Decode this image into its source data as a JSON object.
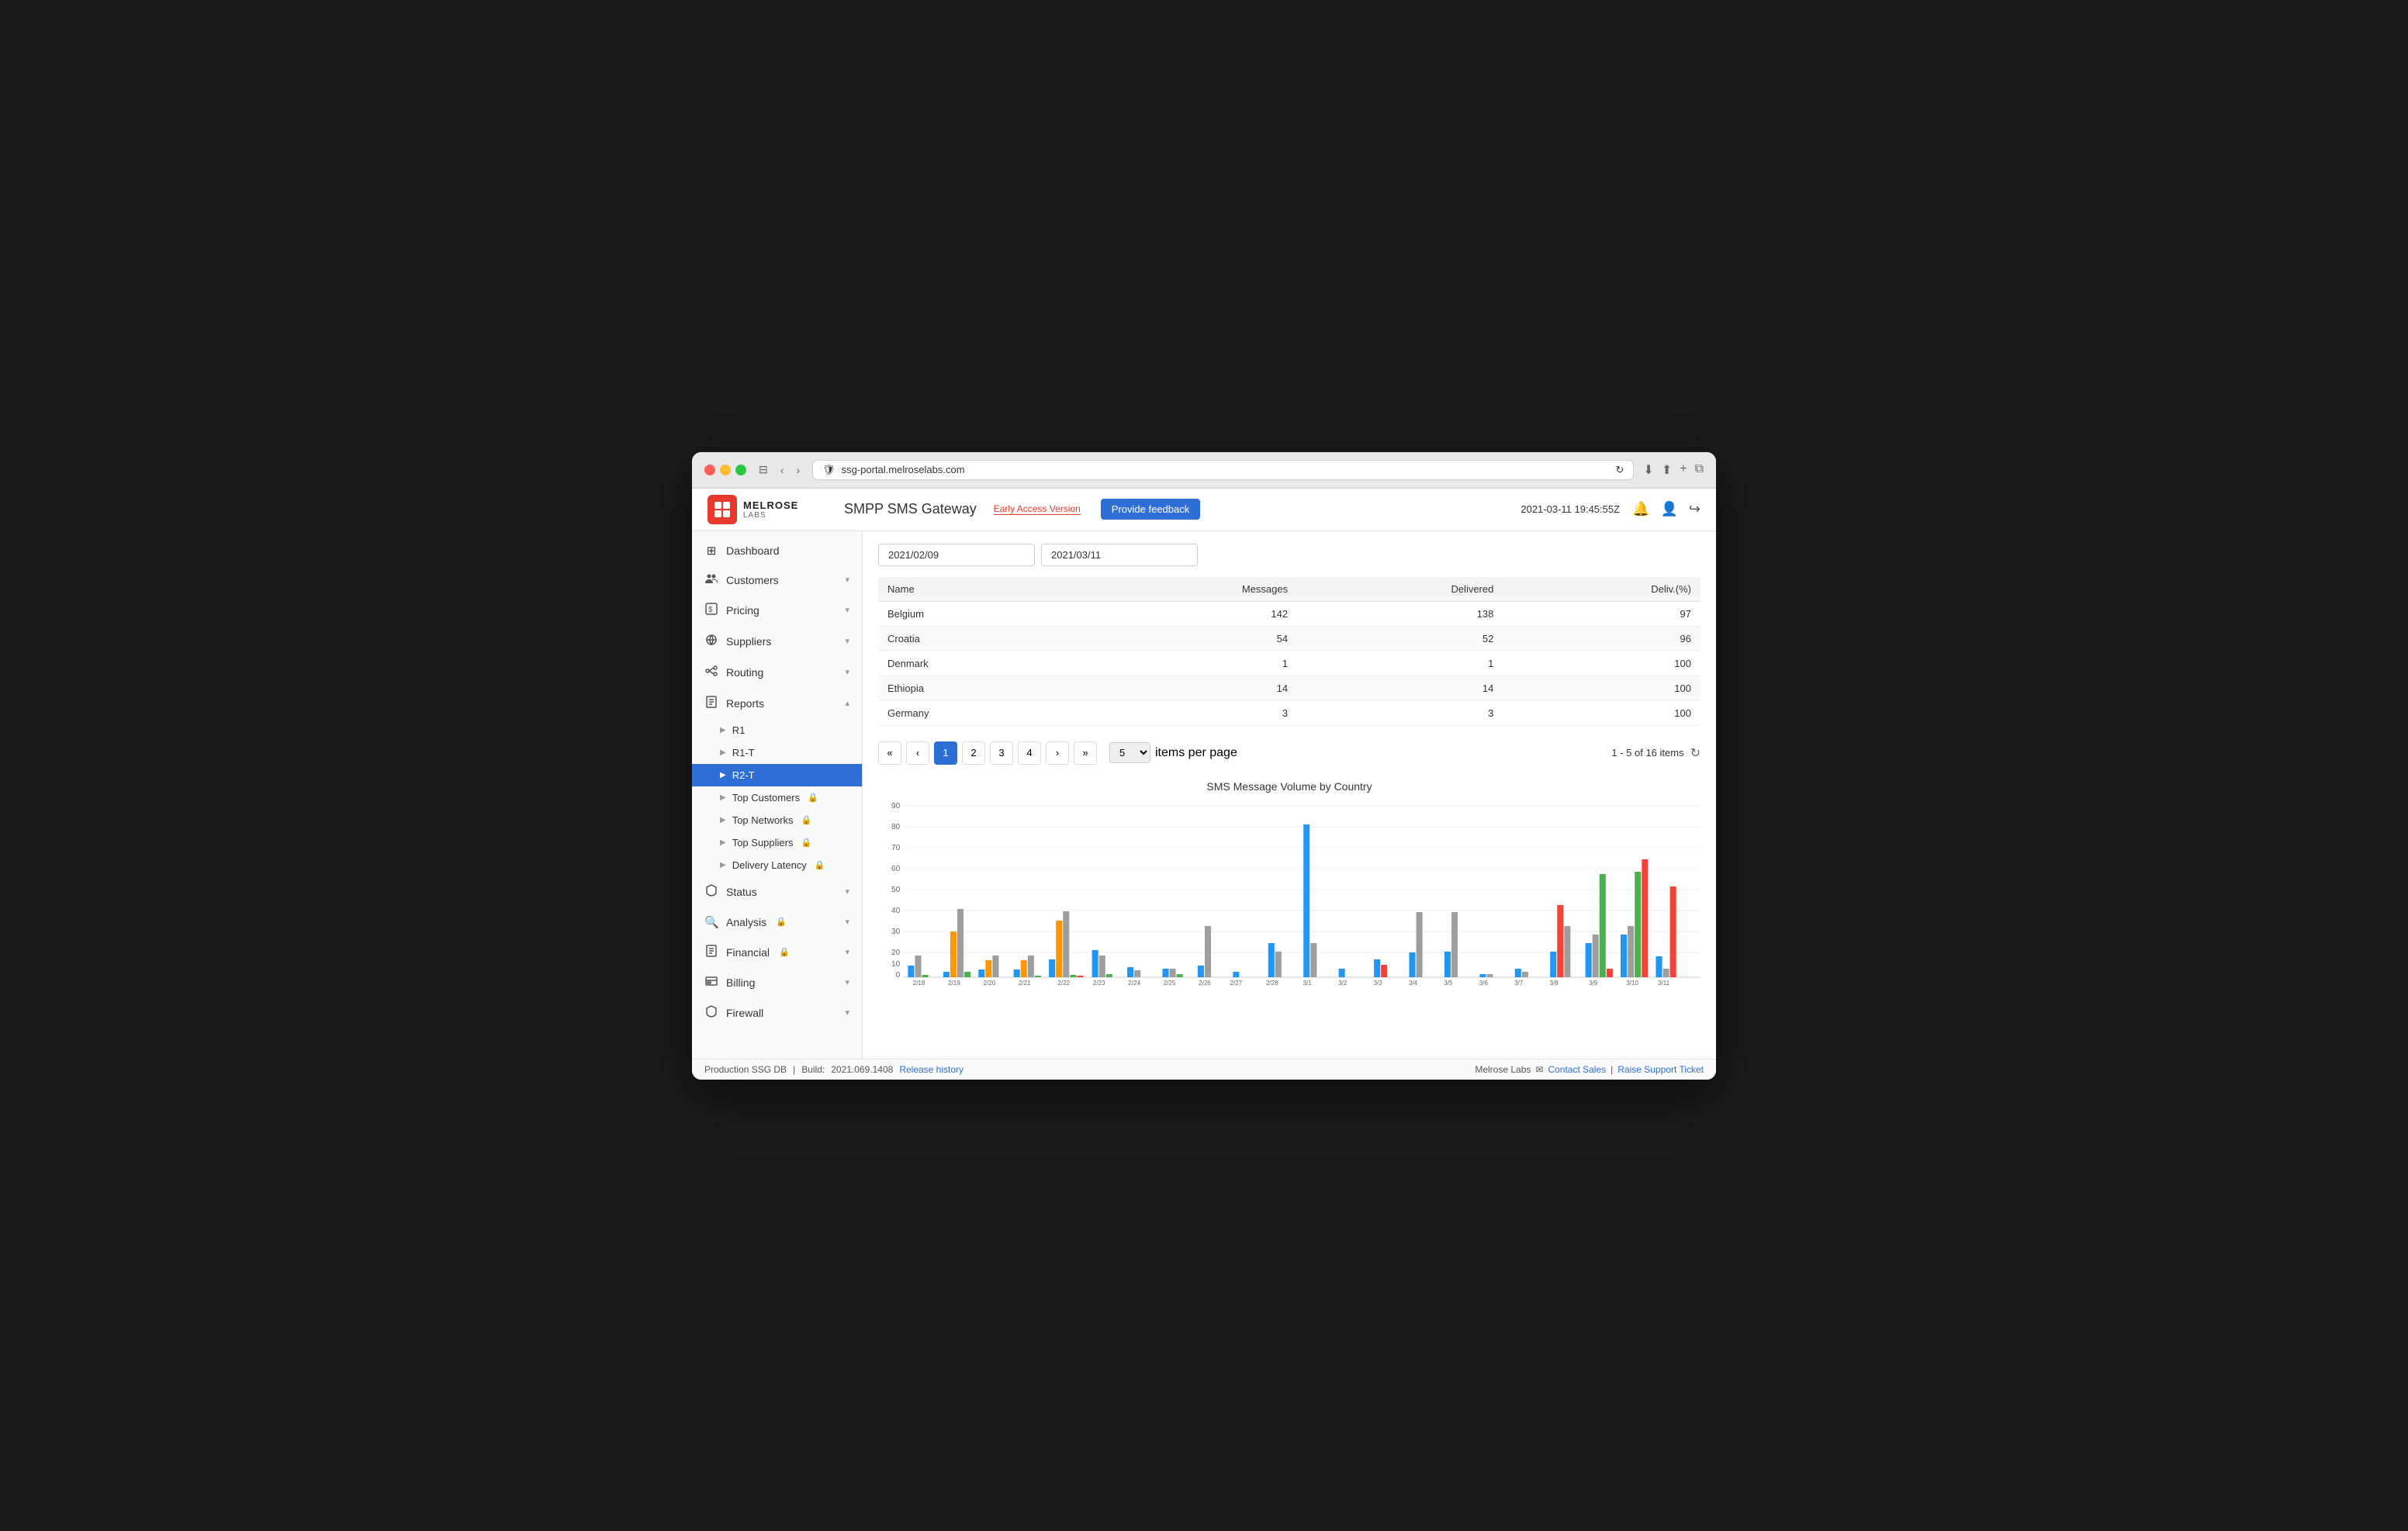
{
  "browser": {
    "url": "ssg-portal.melroselabs.com"
  },
  "app": {
    "title": "SMPP SMS Gateway",
    "badge": "Early Access Version",
    "timestamp": "2021-03-11 19:45:55Z",
    "feedback_btn": "Provide feedback"
  },
  "sidebar": {
    "items": [
      {
        "id": "dashboard",
        "label": "Dashboard",
        "icon": "⊞",
        "active": false
      },
      {
        "id": "customers",
        "label": "Customers",
        "icon": "👥",
        "active": false,
        "has_arrow": true
      },
      {
        "id": "pricing",
        "label": "Pricing",
        "icon": "💲",
        "active": false,
        "has_arrow": true
      },
      {
        "id": "suppliers",
        "label": "Suppliers",
        "icon": "📡",
        "active": false,
        "has_arrow": true
      },
      {
        "id": "routing",
        "label": "Routing",
        "icon": "🔀",
        "active": false,
        "has_arrow": true
      },
      {
        "id": "reports",
        "label": "Reports",
        "icon": "📄",
        "active": false,
        "has_arrow": true,
        "expanded": true
      },
      {
        "id": "status",
        "label": "Status",
        "icon": "🛡",
        "active": false,
        "has_arrow": true
      },
      {
        "id": "analysis",
        "label": "Analysis",
        "icon": "🔍",
        "active": false,
        "has_arrow": true,
        "locked": true
      },
      {
        "id": "financial",
        "label": "Financial",
        "icon": "📋",
        "active": false,
        "has_arrow": true,
        "locked": true
      },
      {
        "id": "billing",
        "label": "Billing",
        "icon": "🏛",
        "active": false,
        "has_arrow": true
      },
      {
        "id": "firewall",
        "label": "Firewall",
        "icon": "🛡",
        "active": false,
        "has_arrow": true
      }
    ],
    "sub_items": [
      {
        "id": "r1",
        "label": "R1",
        "active": false
      },
      {
        "id": "r1t",
        "label": "R1-T",
        "active": false
      },
      {
        "id": "r2t",
        "label": "R2-T",
        "active": true
      },
      {
        "id": "top-customers",
        "label": "Top Customers",
        "active": false,
        "locked": true
      },
      {
        "id": "top-networks",
        "label": "Top Networks",
        "active": false,
        "locked": true
      },
      {
        "id": "top-suppliers",
        "label": "Top Suppliers",
        "active": false,
        "locked": true
      },
      {
        "id": "delivery-latency",
        "label": "Delivery Latency",
        "active": false,
        "locked": true
      }
    ]
  },
  "content": {
    "date_from": "2021/02/09",
    "date_to": "2021/03/11",
    "table": {
      "columns": [
        "Name",
        "Messages",
        "Delivered",
        "Deliv.(%)"
      ],
      "rows": [
        {
          "name": "Belgium",
          "messages": "142",
          "delivered": "138",
          "deliv_pct": "97"
        },
        {
          "name": "Croatia",
          "messages": "54",
          "delivered": "52",
          "deliv_pct": "96"
        },
        {
          "name": "Denmark",
          "messages": "1",
          "delivered": "1",
          "deliv_pct": "100"
        },
        {
          "name": "Ethiopia",
          "messages": "14",
          "delivered": "14",
          "deliv_pct": "100"
        },
        {
          "name": "Germany",
          "messages": "3",
          "delivered": "3",
          "deliv_pct": "100"
        }
      ]
    },
    "pagination": {
      "pages": [
        "1",
        "2",
        "3",
        "4"
      ],
      "current_page": "1",
      "items_per_page": "5",
      "items_label": "items per page",
      "total_info": "1 - 5 of 16 items"
    },
    "chart": {
      "title": "SMS Message Volume by Country",
      "y_max": 90,
      "y_labels": [
        "90",
        "80",
        "70",
        "60",
        "50",
        "40",
        "30",
        "20",
        "10",
        "0"
      ],
      "x_labels": [
        "2/18",
        "2/19",
        "2/20",
        "2/21",
        "2/22",
        "2/23",
        "2/24",
        "2/25",
        "2/26",
        "2/27",
        "2/28",
        "3/1",
        "3/2",
        "3/3",
        "3/4",
        "3/5",
        "3/6",
        "3/7",
        "3/8",
        "3/9",
        "3/10",
        "3/11"
      ],
      "colors": {
        "blue": "#2196F3",
        "orange": "#FF9800",
        "gray": "#9E9E9E",
        "green": "#4CAF50",
        "red": "#F44336",
        "teal": "#00BCD4"
      }
    }
  },
  "status_bar": {
    "env": "Production SSG DB",
    "build_label": "Build:",
    "build": "2021.069.1408",
    "release_history": "Release history",
    "brand": "Melrose Labs",
    "contact_sales": "Contact Sales",
    "support_ticket": "Raise Support Ticket"
  }
}
